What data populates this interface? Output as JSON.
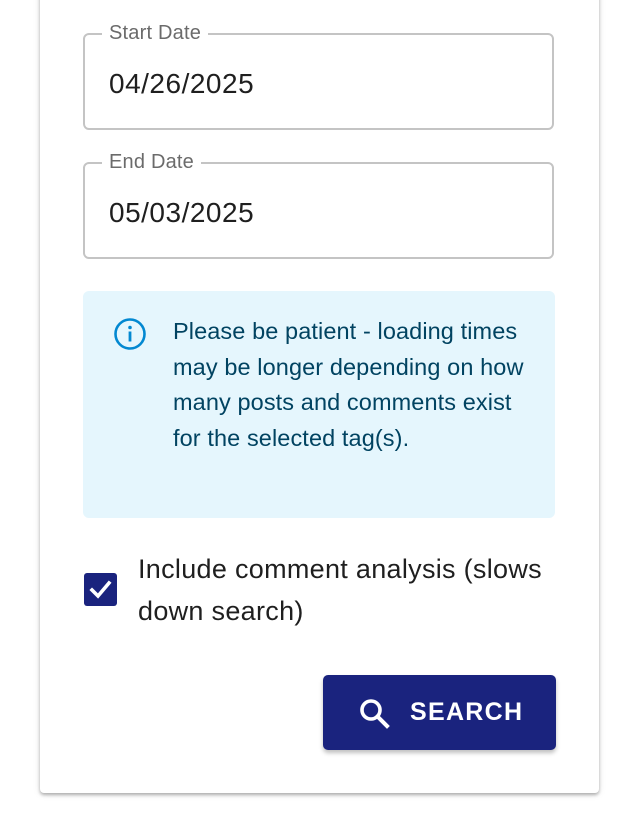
{
  "form": {
    "start_date": {
      "label": "Start Date",
      "value": "04/26/2025"
    },
    "end_date": {
      "label": "End Date",
      "value": "05/03/2025"
    },
    "info_alert": {
      "icon": "info-icon",
      "text": "Please be patient - loading times may be longer depending on how many posts and comments exist for the selected tag(s)."
    },
    "comment_analysis": {
      "checked": true,
      "label": "Include comment analysis (slows down search)"
    },
    "search_button": {
      "icon": "search-icon",
      "label": "SEARCH"
    }
  },
  "colors": {
    "primary": "#1a237e",
    "alert_background": "#e5f6fd",
    "alert_text": "#014361",
    "alert_icon": "#0288d1",
    "field_border": "#c4c4c4"
  }
}
